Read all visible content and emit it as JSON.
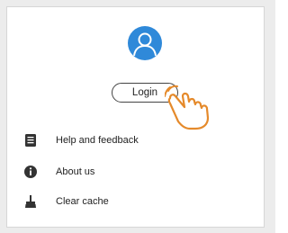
{
  "login": {
    "label": "Login"
  },
  "menu": {
    "items": [
      {
        "label": "Help and feedback",
        "icon": "document-list-icon"
      },
      {
        "label": "About us",
        "icon": "info-icon"
      },
      {
        "label": "Clear cache",
        "icon": "broom-icon"
      }
    ]
  },
  "colors": {
    "avatar": "#2f89d9",
    "hand_outline": "#e58a2b",
    "text": "#222222",
    "icon": "#333333"
  },
  "icons": {
    "avatar": "user-avatar-icon",
    "pointer": "pointing-hand-icon"
  }
}
